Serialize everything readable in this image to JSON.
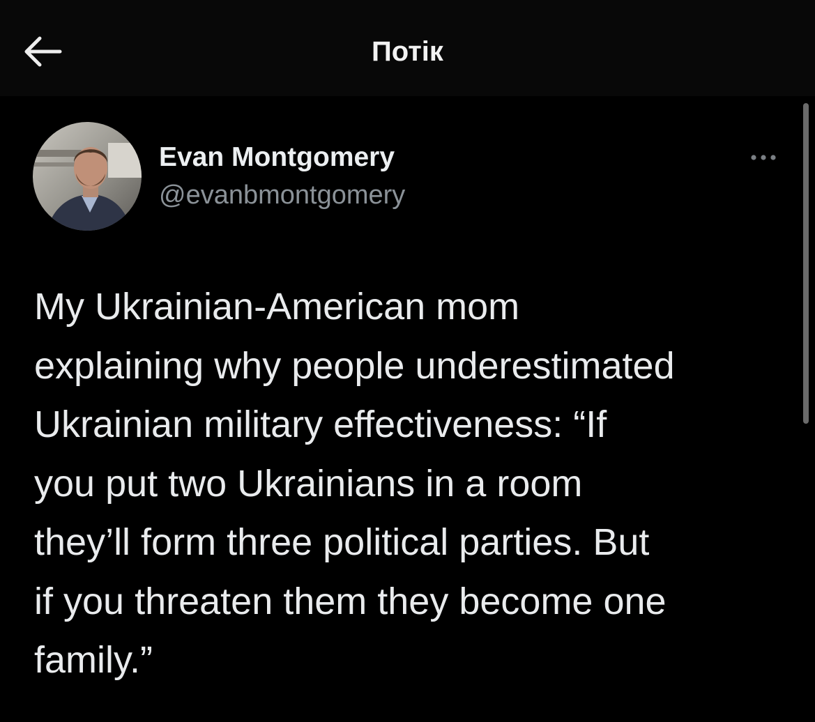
{
  "header": {
    "title": "Потік",
    "back_icon": "arrow-left-icon"
  },
  "tweet": {
    "author": {
      "display_name": "Evan Montgomery",
      "handle": "@evanbmontgomery"
    },
    "more_icon": "more-horizontal-icon",
    "text": "My Ukrainian-American mom\nexplaining why people underestimated\nUkrainian military effectiveness: “If\nyou put two Ukrainians in a room\nthey’ll form three political parties. But\nif you threaten them they become one\nfamily.”"
  },
  "colors": {
    "background": "#000000",
    "header_background": "#080808",
    "text_primary": "#e7e9ea",
    "text_secondary": "#8b9298"
  }
}
